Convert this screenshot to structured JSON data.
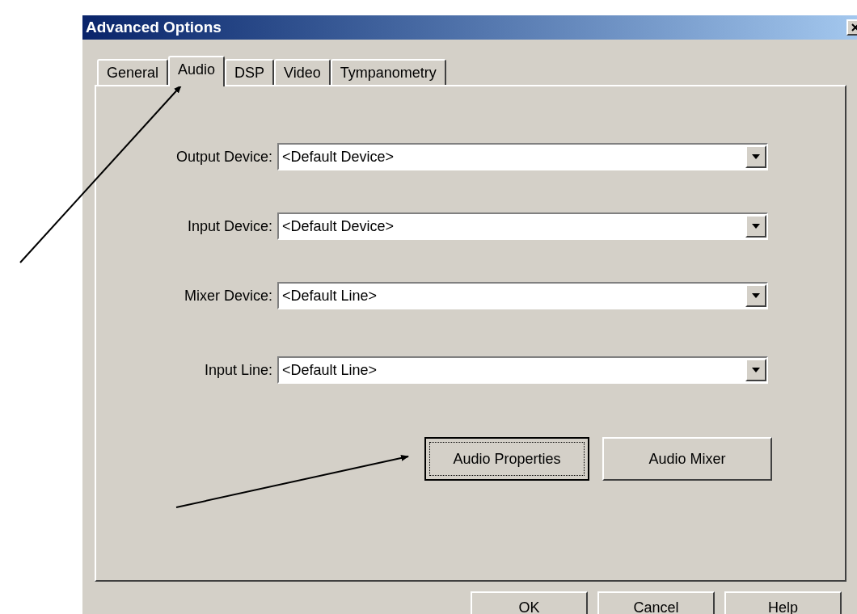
{
  "window": {
    "title": "Advanced Options"
  },
  "tabs": [
    {
      "label": "General",
      "selected": false
    },
    {
      "label": "Audio",
      "selected": true
    },
    {
      "label": "DSP",
      "selected": false
    },
    {
      "label": "Video",
      "selected": false
    },
    {
      "label": "Tympanometry",
      "selected": false
    }
  ],
  "fields": [
    {
      "label": "Output Device:",
      "value": "<Default Device>"
    },
    {
      "label": "Input Device:",
      "value": "<Default Device>"
    },
    {
      "label": "Mixer Device:",
      "value": "<Default Line>"
    },
    {
      "label": "Input Line:",
      "value": "<Default Line>"
    }
  ],
  "panel_buttons": [
    {
      "label": "Audio Properties",
      "focused": true
    },
    {
      "label": "Audio Mixer",
      "focused": false
    }
  ],
  "dialog_buttons": [
    "OK",
    "Cancel",
    "Help"
  ]
}
